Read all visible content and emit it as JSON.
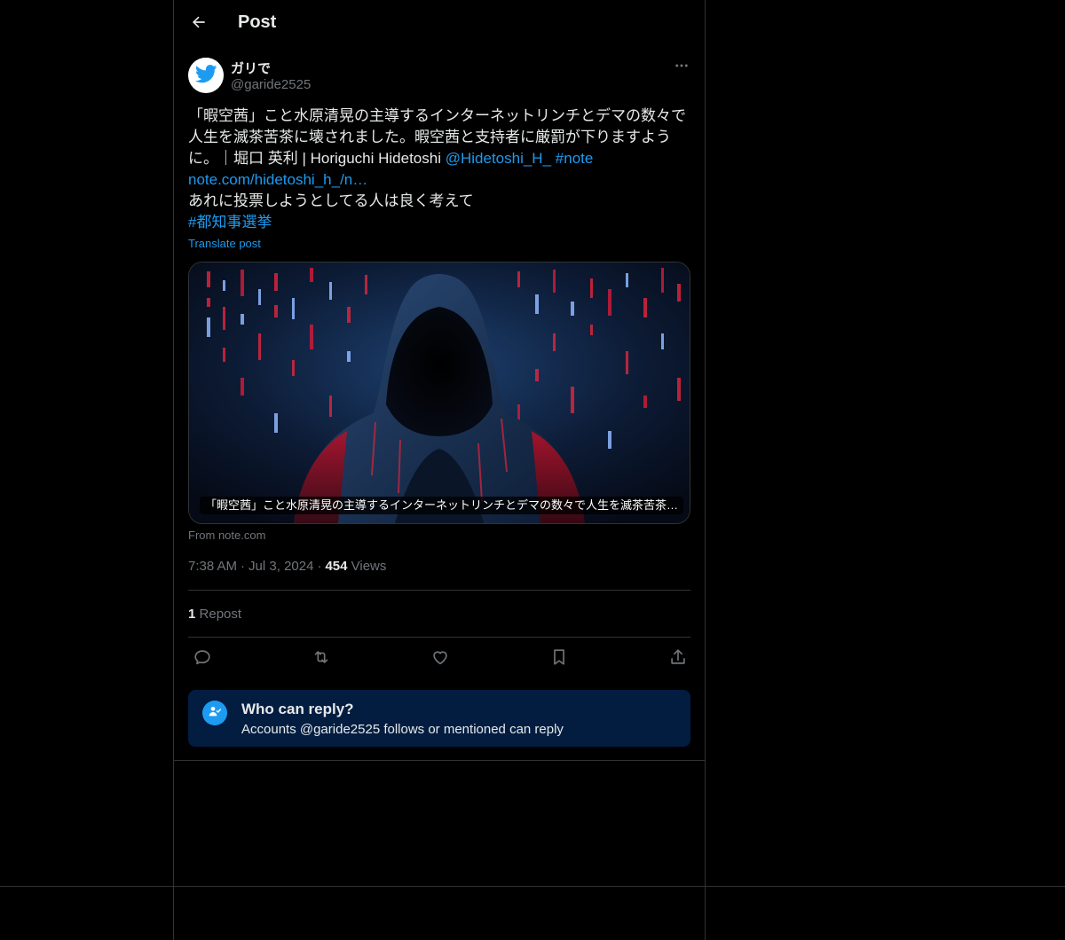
{
  "header": {
    "title": "Post"
  },
  "author": {
    "display_name": "ガリで",
    "handle": "@garide2525"
  },
  "post": {
    "line1": "「暇空茜」こと水原清晃の主導するインターネットリンチとデマの数々で",
    "line2": "人生を滅茶苦茶に壊されました。暇空茜と支持者に厳罰が下りますよう",
    "line3_text": "に。｜堀口 英利 | Horiguchi Hidetoshi ",
    "mention": "@Hidetoshi_H_",
    "hashtag_note": "#note",
    "url": "note.com/hidetoshi_h_/n…",
    "line5": "あれに投票しようとしてる人は良く考えて",
    "hashtag_election": "#都知事選挙",
    "translate_label": "Translate post"
  },
  "card": {
    "caption": "「暇空茜」こと水原清晃の主導するインターネットリンチとデマの数々で人生を滅茶苦茶…",
    "source": "From note.com"
  },
  "meta": {
    "time": "7:38 AM",
    "separator": "·",
    "date": "Jul 3, 2024",
    "views_count": "454",
    "views_label": "Views"
  },
  "stats": {
    "repost_count": "1",
    "repost_label": "Repost"
  },
  "icons": {
    "back": "arrow-left-icon",
    "more": "more-horizontal-icon",
    "reply": "reply-bubble-icon",
    "retweet": "retweet-icon",
    "like": "heart-icon",
    "bookmark": "bookmark-icon",
    "share": "share-icon",
    "who_can_reply": "person-check-icon"
  },
  "who_can_reply": {
    "title": "Who can reply?",
    "description": "Accounts @garide2525 follows or mentioned can reply"
  },
  "colors": {
    "background": "#000000",
    "text_primary": "#e7e9ea",
    "text_secondary": "#71767b",
    "accent": "#1d9bf0",
    "border": "#2f3336",
    "reply_box_bg": "#031d41"
  }
}
